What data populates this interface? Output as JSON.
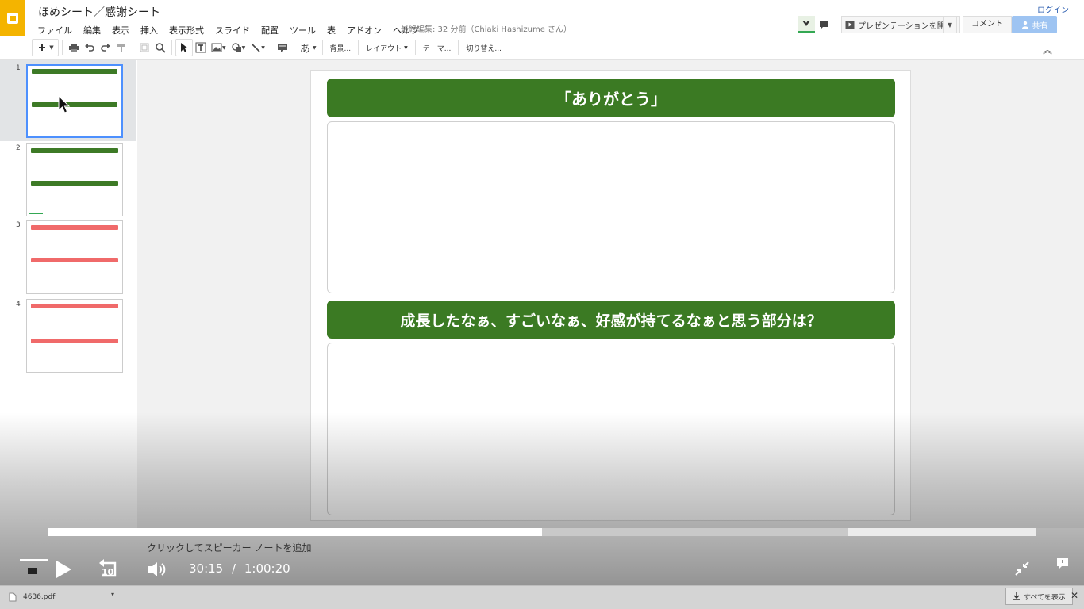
{
  "app": {
    "doc_title": "ほめシート／感謝シート",
    "menu": [
      "ファイル",
      "編集",
      "表示",
      "挿入",
      "表示形式",
      "スライド",
      "配置",
      "ツール",
      "表",
      "アドオン",
      "ヘルプ"
    ],
    "last_edit": "最終編集: 32 分前（Chiaki Hashizume さん）",
    "login": "ログイン",
    "present_label": "プレゼンテーションを開始",
    "comment_label": "コメント",
    "share_label": "共有"
  },
  "toolbar": {
    "text_tool": "あ",
    "background": "背景...",
    "layout": "レイアウト",
    "theme": "テーマ...",
    "transition": "切り替え..."
  },
  "filmstrip": {
    "slides": [
      {
        "num": "1"
      },
      {
        "num": "2"
      },
      {
        "num": "3"
      },
      {
        "num": "4"
      }
    ]
  },
  "slide": {
    "header1": "「ありがとう」",
    "header2": "成長したなぁ、すごいなぁ、好感が持てるなぁと思う部分は？"
  },
  "player": {
    "notes_hint": "クリックしてスピーカー ノートを追加",
    "current_time": "30:15",
    "separator": "/",
    "duration": "1:00:20",
    "played_fraction": 0.5,
    "buffered_fraction": 0.81,
    "rewind_seconds": "10"
  },
  "downloads": {
    "file_name": "4636.pdf",
    "show_all": "すべてを表示"
  },
  "colors": {
    "slide_green": "#3b7a23",
    "thumb_red": "#f06a6a",
    "logo_yellow": "#f4b400",
    "share_blue": "#9ec4f2"
  }
}
